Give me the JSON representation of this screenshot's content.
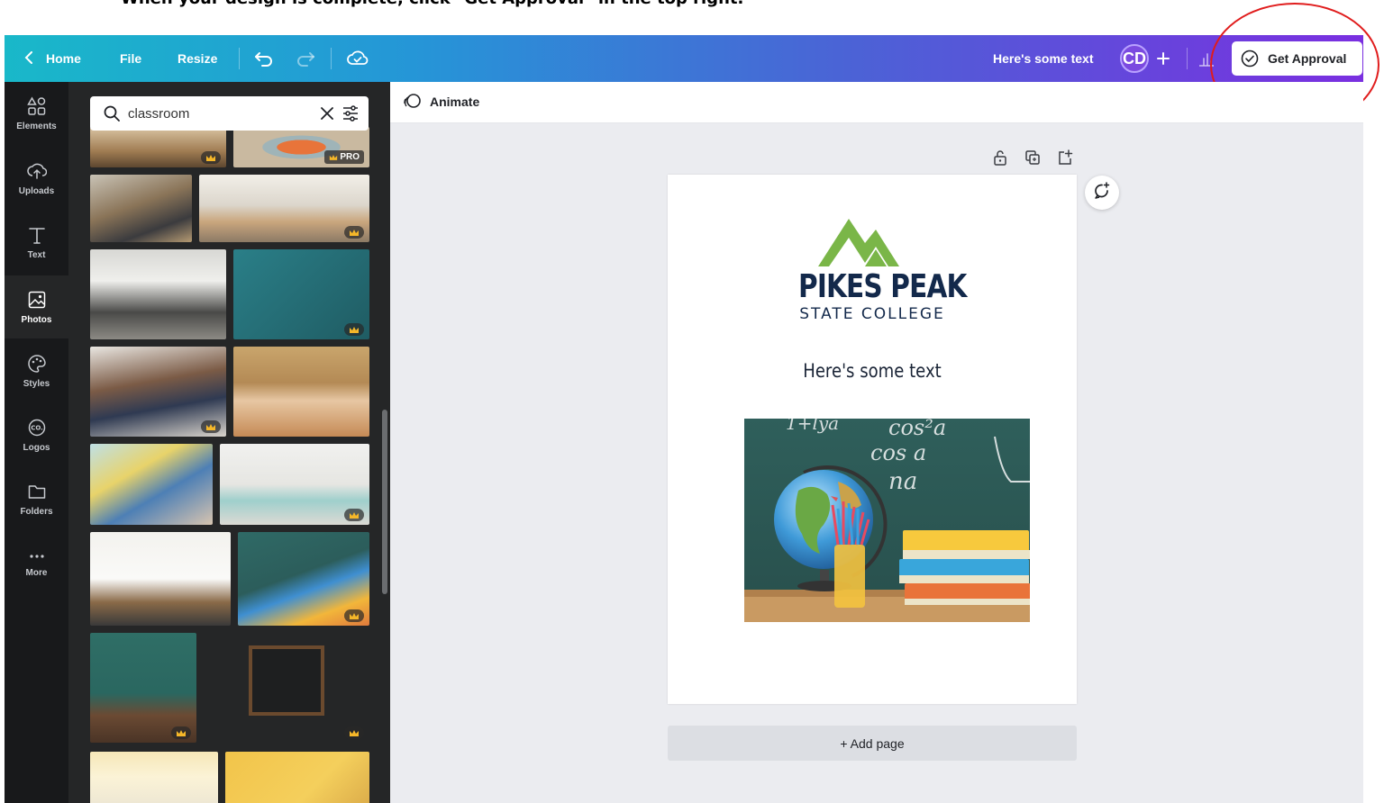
{
  "instruction": "When your design is complete, click \"Get Approval\" in the top right.",
  "topbar": {
    "home_label": "Home",
    "file_label": "File",
    "resize_label": "Resize",
    "design_title": "Here's some text",
    "avatar_initials": "CD",
    "approval_label": "Get Approval"
  },
  "rail": {
    "items": [
      {
        "label": "Elements",
        "icon": "elements-icon"
      },
      {
        "label": "Uploads",
        "icon": "uploads-icon"
      },
      {
        "label": "Text",
        "icon": "text-icon"
      },
      {
        "label": "Photos",
        "icon": "photos-icon"
      },
      {
        "label": "Styles",
        "icon": "styles-icon"
      },
      {
        "label": "Logos",
        "icon": "logos-icon"
      },
      {
        "label": "Folders",
        "icon": "folders-icon"
      },
      {
        "label": "More",
        "icon": "more-icon"
      }
    ],
    "active": "Photos"
  },
  "panel": {
    "search_value": "classroom",
    "pro_label": "PRO"
  },
  "editor": {
    "animate_label": "Animate",
    "add_page_label": "+ Add page"
  },
  "design": {
    "logo_name": "PIKES PEAK",
    "logo_sub": "STATE COLLEGE",
    "heading": "Here's some text"
  },
  "colors": {
    "topbar_start": "#19b8c9",
    "topbar_end": "#7a2fe0",
    "rail_bg": "#18191b",
    "panel_bg": "#252627",
    "canvas_bg": "#ebecf0",
    "logo_navy": "#13294b",
    "logo_green": "#7ab648",
    "highlight_circle": "#e01c1c"
  }
}
